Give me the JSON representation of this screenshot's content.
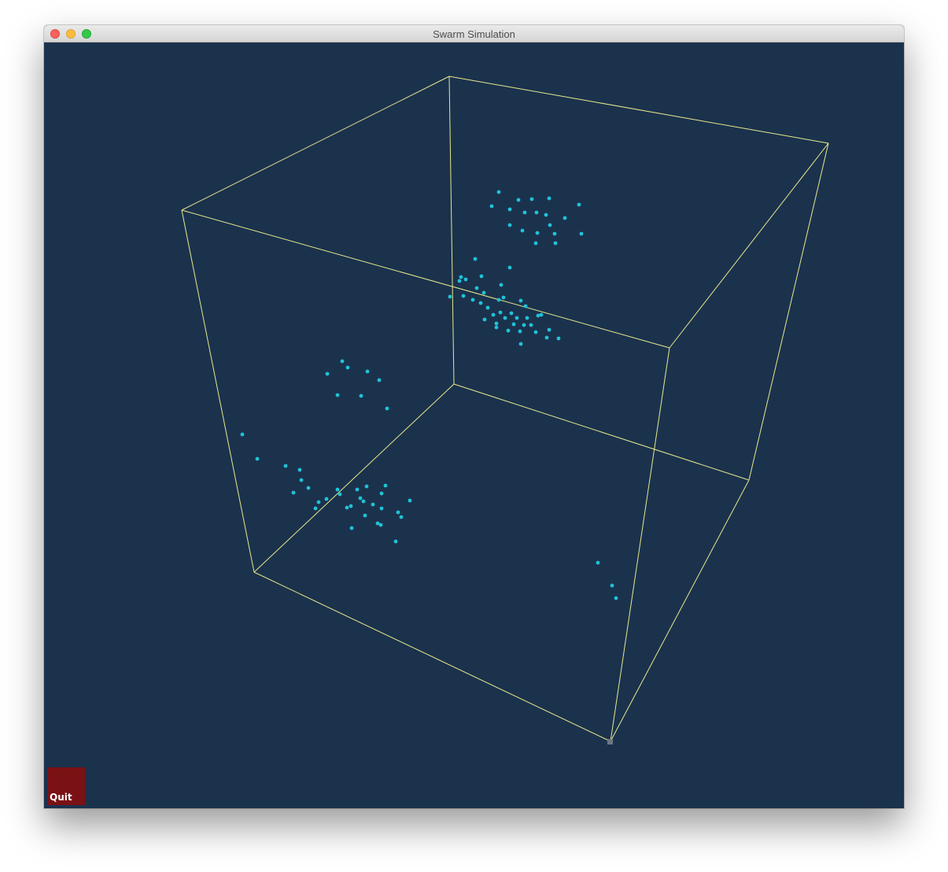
{
  "window": {
    "title": "Swarm Simulation"
  },
  "colors": {
    "background": "#1b324d",
    "cube_edges": "#e7e98c",
    "particles": "#1fc3d6",
    "quit_button": "#7a1114",
    "quit_text": "#ffffff"
  },
  "controls": {
    "quit_label": "Quit"
  }
}
